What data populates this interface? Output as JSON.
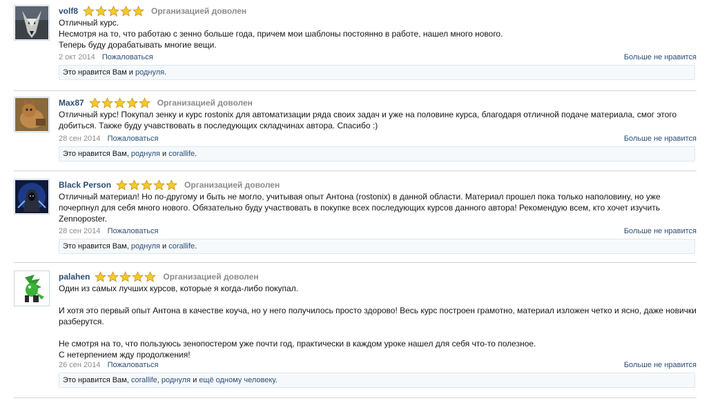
{
  "reviews": [
    {
      "username": "volf8",
      "avatar": "wolf-avatar",
      "rating": 5,
      "satisfaction": "Организацией доволен",
      "text": "Отличный курс.\nНесмотря на то, что работаю с зенно больше года, причем мои шаблоны постоянно в работе, нашел много нового.\nТеперь буду дорабатывать многие вещи.",
      "date": "2 окт 2014",
      "report_label": "Пожаловаться",
      "unlike_label": "Больше не нравится",
      "likes_prefix": "Это нравится Вам и ",
      "likes_users": [
        "роднуля"
      ],
      "likes_suffix": "."
    },
    {
      "username": "Max87",
      "avatar": "cat-avatar",
      "rating": 5,
      "satisfaction": "Организацией доволен",
      "text": "Отличный курс! Покупал зенку и курс rostonix для автоматизации ряда своих задач и уже на половине курса, благодаря отличной подаче материала, смог этого добиться. Также буду учавствовать в последующих складчинах автора. Спасибо :)",
      "date": "28 сен 2014",
      "report_label": "Пожаловаться",
      "unlike_label": "Больше не нравится",
      "likes_prefix": "Это нравится Вам, ",
      "likes_users": [
        "роднуля",
        "corallife"
      ],
      "likes_join": " и ",
      "likes_suffix": "."
    },
    {
      "username": "Black Person",
      "avatar": "hooded-figure-avatar",
      "rating": 5,
      "satisfaction": "Организацией доволен",
      "text": "Отличный материал! Но по-другому и быть не могло, учитывая опыт Антона (rostonix) в данной области. Материал прошел пока только наполовину, но уже почерпнул для себя много нового. Обязательно буду участвовать в покупке всех последующих курсов данного автора! Рекомендую всем, кто хочет изучить Zennoposter.",
      "date": "28 сен 2014",
      "report_label": "Пожаловаться",
      "unlike_label": "Больше не нравится",
      "likes_prefix": "Это нравится Вам, ",
      "likes_users": [
        "роднуля",
        "corallife"
      ],
      "likes_join": " и ",
      "likes_suffix": "."
    },
    {
      "username": "palahen",
      "avatar": "green-hedgehog-avatar",
      "rating": 5,
      "satisfaction": "Организацией доволен",
      "text": "Один из самых лучших курсов, которые я когда-либо покупал.\n\nИ хотя это первый опыт Антона в качестве коуча, но у него получилось просто здорово! Весь курс построен грамотно, материал изложен четко и ясно, даже новички разберутся.\n\nНе смотря на то, что пользуюсь зенопостером уже почти год, практически в каждом уроке нашел для себя что-то полезное.\nС нетерпением жду продолжения!",
      "date": "26 сен 2014",
      "report_label": "Пожаловаться",
      "unlike_label": "Больше не нравится",
      "likes_prefix": "Это нравится Вам, ",
      "likes_users": [
        "corallife",
        "роднуля",
        "ещё одному человеку"
      ],
      "likes_sep": ", ",
      "likes_join": " и ",
      "likes_suffix": "."
    }
  ],
  "colors": {
    "link": "#2b4d73",
    "muted": "#8c8c8c",
    "likes_bg": "#f6f9fc",
    "likes_border": "#dbe6f1",
    "star_fill": "#f7c928"
  }
}
